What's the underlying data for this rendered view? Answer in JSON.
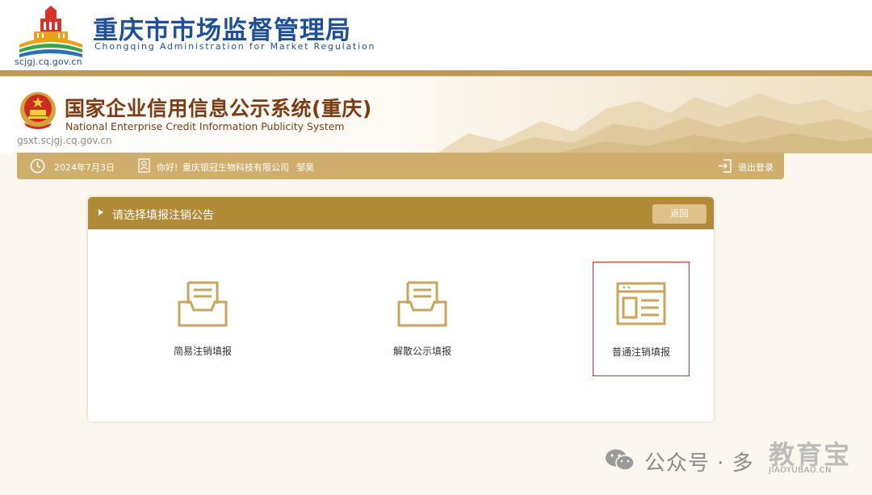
{
  "site": {
    "title_cn": "重庆市市场监督管理局",
    "title_en": "Chongqing  Administration for Market Regulation",
    "domain": "scjgj.cq.gov.cn"
  },
  "system": {
    "title_cn": "国家企业信用信息公示系统(重庆)",
    "title_en": "National Enterprise Credit Information Publicity System",
    "domain": "gsxt.scjgj.cq.gov.cn"
  },
  "infobar": {
    "date": "2024年7月3日",
    "greeting": "你好!",
    "company": "重庆银冠生物科技有限公司",
    "user": "邹昊",
    "logout_label": "退出登录"
  },
  "panel": {
    "title": "请选择填报注销公告",
    "back_label": "返回",
    "options": [
      {
        "label": "简易注销填报",
        "icon": "inbox-document-icon"
      },
      {
        "label": "解散公示填报",
        "icon": "inbox-document-icon"
      },
      {
        "label": "普通注销填报",
        "icon": "browser-window-icon",
        "highlighted": true
      }
    ]
  },
  "watermark": {
    "text": "公众号 · 多",
    "brand": "教育宝",
    "brand_en": "JIAOYUBAO.CN"
  },
  "colors": {
    "site_blue": "#1f4f97",
    "system_brown": "#7c3b13",
    "gold": "#bd9a56",
    "info_bar": "#cfae6d",
    "panel_header": "#b08a36",
    "highlight_border": "#d8282d"
  }
}
